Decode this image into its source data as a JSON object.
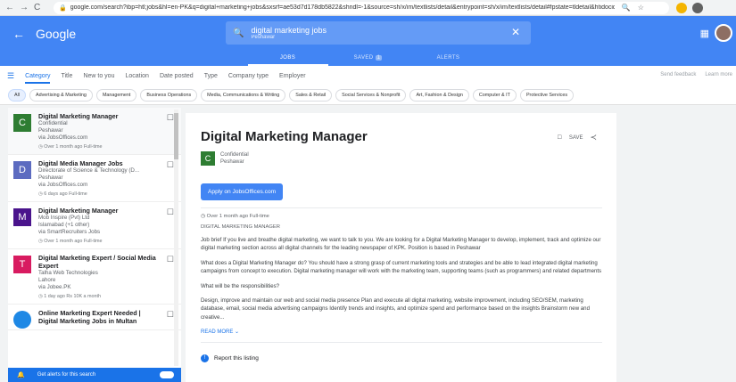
{
  "browser": {
    "url": "google.com/search?ibp=htl;jobs&hl=en-PK&q=digital+marketing+jobs&sxsrf=ae53d7d178db5822&shndl=-1&source=sh/x/im/textlists/detail&entrypoint=sh/x/im/textlists/detail#fpstate=tldetail&htidocid..."
  },
  "header": {
    "logo": "Google",
    "query": "digital marketing jobs",
    "location": "Peshawar"
  },
  "tabs": [
    {
      "label": "JOBS"
    },
    {
      "label": "SAVED",
      "badge": "1"
    },
    {
      "label": "ALERTS"
    }
  ],
  "filters": {
    "items": [
      "Category",
      "Title",
      "New to you",
      "Location",
      "Date posted",
      "Type",
      "Company type",
      "Employer"
    ],
    "send_feedback": "Send feedback",
    "learn_more": "Learn more"
  },
  "chips": [
    "All",
    "Advertising & Marketing",
    "Management",
    "Business Operations",
    "Media, Communications & Writing",
    "Sales & Retail",
    "Social Services & Nonprofit",
    "Art, Fashion & Design",
    "Computer & IT",
    "Protective Services"
  ],
  "jobs": [
    {
      "letter": "C",
      "color": "#2e7d32",
      "title": "Digital Marketing Manager",
      "company": "Confidential",
      "location": "Peshawar",
      "via": "via JobsOffices.com",
      "meta": "Over 1 month ago  Full-time"
    },
    {
      "letter": "D",
      "color": "#5c6bc0",
      "title": "Digital Media Manager Jobs",
      "company": "Directorate of Science & Technology (D...",
      "location": "Peshawar",
      "via": "via JobsOffices.com",
      "meta": "6 days ago  Full-time"
    },
    {
      "letter": "M",
      "color": "#4a148c",
      "title": "Digital Marketing Manager",
      "company": "Mob Inspire (Pvt) Ltd",
      "location": "Islamabad (+1 other)",
      "via": "via SmartRecruiters Jobs",
      "meta": "Over 1 month ago  Full-time"
    },
    {
      "letter": "T",
      "color": "#d81b60",
      "title": "Digital Marketing Expert / Social Media Expert",
      "company": "Talha Web Technologies",
      "location": "Lahore",
      "via": "via Jobee.PK",
      "meta": "1 day ago  Rs 10K a month"
    },
    {
      "letter": "",
      "color": "#1e88e5",
      "title": "Online Marketing Expert Needed | Digital Marketing Jobs in Multan",
      "company": "",
      "location": "",
      "via": "",
      "meta": ""
    }
  ],
  "alerts_label": "Get alerts for this search",
  "detail": {
    "title": "Digital Marketing Manager",
    "save": "SAVE",
    "company": "Confidential",
    "location": "Peshawar",
    "apply": "Apply on JobsOffices.com",
    "meta": "Over 1 month ago   Full-time",
    "heading": "DIGITAL MARKETING MANAGER",
    "p1": "Job brief If you live and breathe digital marketing, we want to talk to you. We are looking for a Digital Marketing Manager to develop, implement, track and optimize our digital marketing section across all digital channels for the leading newspaper of KPK. Position is based in Peshawar",
    "p2": "What does a Digital Marketing Manager do? You should have a strong grasp of current marketing tools and strategies and be able to lead integrated digital marketing campaigns from concept to execution. Digital marketing manager will work with the marketing team, supporting teams (such as programmers) and related departments",
    "p3": "What will be the responsibilities?",
    "p4": "Design, improve and maintain our web and social media presence Plan and execute all digital marketing, website improvement, including SEO/SEM, marketing database, email, social media advertising campaigns Identify trends and insights, and optimize spend and performance based on the insights Brainstorm new and creative...",
    "read_more": "READ MORE",
    "report": "Report this listing"
  }
}
